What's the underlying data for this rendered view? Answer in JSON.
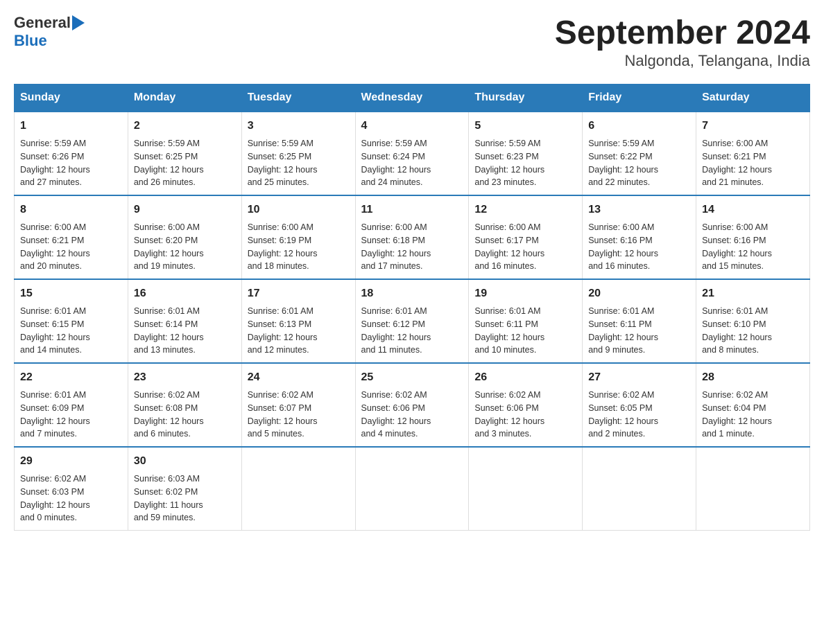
{
  "header": {
    "logo_text_main": "General",
    "logo_text_blue": "Blue",
    "calendar_title": "September 2024",
    "calendar_subtitle": "Nalgonda, Telangana, India"
  },
  "weekdays": [
    "Sunday",
    "Monday",
    "Tuesday",
    "Wednesday",
    "Thursday",
    "Friday",
    "Saturday"
  ],
  "weeks": [
    [
      {
        "day": "1",
        "sunrise": "5:59 AM",
        "sunset": "6:26 PM",
        "daylight": "12 hours and 27 minutes."
      },
      {
        "day": "2",
        "sunrise": "5:59 AM",
        "sunset": "6:25 PM",
        "daylight": "12 hours and 26 minutes."
      },
      {
        "day": "3",
        "sunrise": "5:59 AM",
        "sunset": "6:25 PM",
        "daylight": "12 hours and 25 minutes."
      },
      {
        "day": "4",
        "sunrise": "5:59 AM",
        "sunset": "6:24 PM",
        "daylight": "12 hours and 24 minutes."
      },
      {
        "day": "5",
        "sunrise": "5:59 AM",
        "sunset": "6:23 PM",
        "daylight": "12 hours and 23 minutes."
      },
      {
        "day": "6",
        "sunrise": "5:59 AM",
        "sunset": "6:22 PM",
        "daylight": "12 hours and 22 minutes."
      },
      {
        "day": "7",
        "sunrise": "6:00 AM",
        "sunset": "6:21 PM",
        "daylight": "12 hours and 21 minutes."
      }
    ],
    [
      {
        "day": "8",
        "sunrise": "6:00 AM",
        "sunset": "6:21 PM",
        "daylight": "12 hours and 20 minutes."
      },
      {
        "day": "9",
        "sunrise": "6:00 AM",
        "sunset": "6:20 PM",
        "daylight": "12 hours and 19 minutes."
      },
      {
        "day": "10",
        "sunrise": "6:00 AM",
        "sunset": "6:19 PM",
        "daylight": "12 hours and 18 minutes."
      },
      {
        "day": "11",
        "sunrise": "6:00 AM",
        "sunset": "6:18 PM",
        "daylight": "12 hours and 17 minutes."
      },
      {
        "day": "12",
        "sunrise": "6:00 AM",
        "sunset": "6:17 PM",
        "daylight": "12 hours and 16 minutes."
      },
      {
        "day": "13",
        "sunrise": "6:00 AM",
        "sunset": "6:16 PM",
        "daylight": "12 hours and 16 minutes."
      },
      {
        "day": "14",
        "sunrise": "6:00 AM",
        "sunset": "6:16 PM",
        "daylight": "12 hours and 15 minutes."
      }
    ],
    [
      {
        "day": "15",
        "sunrise": "6:01 AM",
        "sunset": "6:15 PM",
        "daylight": "12 hours and 14 minutes."
      },
      {
        "day": "16",
        "sunrise": "6:01 AM",
        "sunset": "6:14 PM",
        "daylight": "12 hours and 13 minutes."
      },
      {
        "day": "17",
        "sunrise": "6:01 AM",
        "sunset": "6:13 PM",
        "daylight": "12 hours and 12 minutes."
      },
      {
        "day": "18",
        "sunrise": "6:01 AM",
        "sunset": "6:12 PM",
        "daylight": "12 hours and 11 minutes."
      },
      {
        "day": "19",
        "sunrise": "6:01 AM",
        "sunset": "6:11 PM",
        "daylight": "12 hours and 10 minutes."
      },
      {
        "day": "20",
        "sunrise": "6:01 AM",
        "sunset": "6:11 PM",
        "daylight": "12 hours and 9 minutes."
      },
      {
        "day": "21",
        "sunrise": "6:01 AM",
        "sunset": "6:10 PM",
        "daylight": "12 hours and 8 minutes."
      }
    ],
    [
      {
        "day": "22",
        "sunrise": "6:01 AM",
        "sunset": "6:09 PM",
        "daylight": "12 hours and 7 minutes."
      },
      {
        "day": "23",
        "sunrise": "6:02 AM",
        "sunset": "6:08 PM",
        "daylight": "12 hours and 6 minutes."
      },
      {
        "day": "24",
        "sunrise": "6:02 AM",
        "sunset": "6:07 PM",
        "daylight": "12 hours and 5 minutes."
      },
      {
        "day": "25",
        "sunrise": "6:02 AM",
        "sunset": "6:06 PM",
        "daylight": "12 hours and 4 minutes."
      },
      {
        "day": "26",
        "sunrise": "6:02 AM",
        "sunset": "6:06 PM",
        "daylight": "12 hours and 3 minutes."
      },
      {
        "day": "27",
        "sunrise": "6:02 AM",
        "sunset": "6:05 PM",
        "daylight": "12 hours and 2 minutes."
      },
      {
        "day": "28",
        "sunrise": "6:02 AM",
        "sunset": "6:04 PM",
        "daylight": "12 hours and 1 minute."
      }
    ],
    [
      {
        "day": "29",
        "sunrise": "6:02 AM",
        "sunset": "6:03 PM",
        "daylight": "12 hours and 0 minutes."
      },
      {
        "day": "30",
        "sunrise": "6:03 AM",
        "sunset": "6:02 PM",
        "daylight": "11 hours and 59 minutes."
      },
      null,
      null,
      null,
      null,
      null
    ]
  ],
  "labels": {
    "sunrise_prefix": "Sunrise: ",
    "sunset_prefix": "Sunset: ",
    "daylight_prefix": "Daylight: "
  }
}
